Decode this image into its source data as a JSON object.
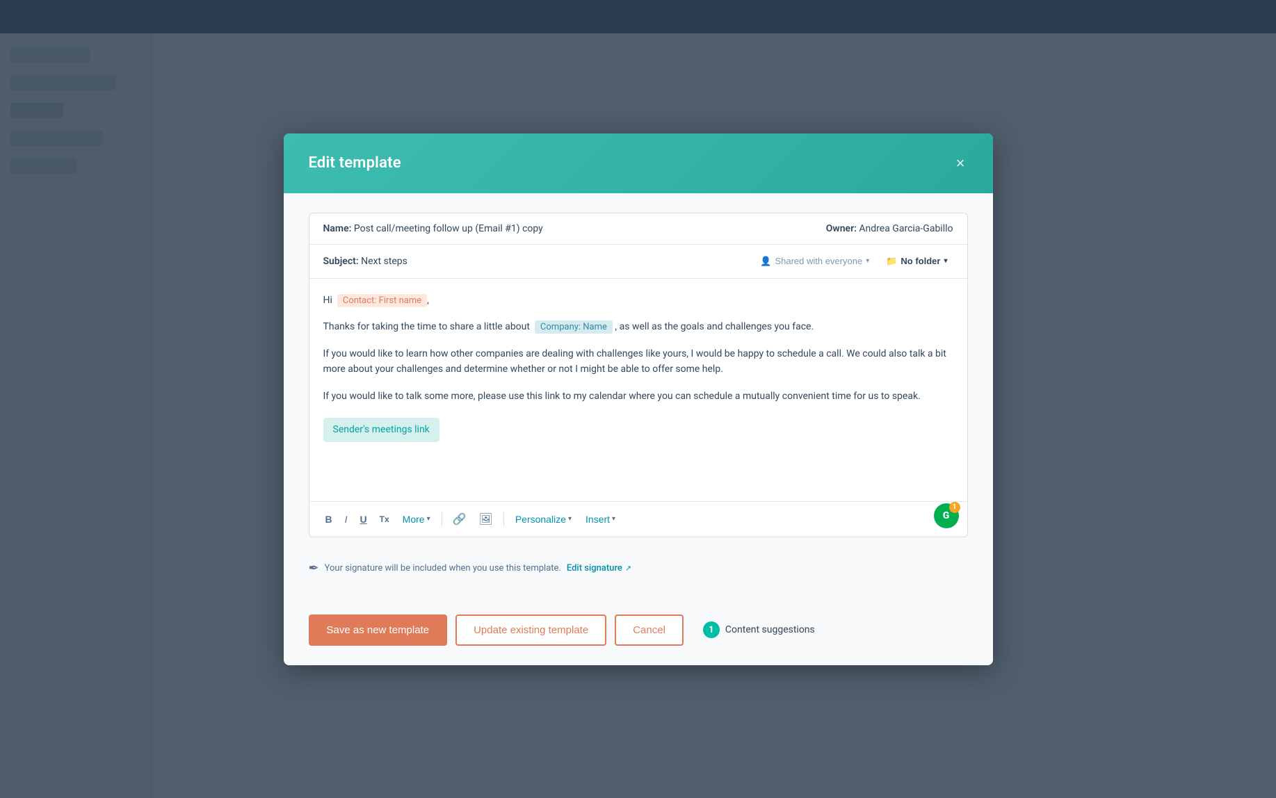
{
  "background": {
    "topbar_color": "#2d3e50",
    "sidebar_color": "#e8edf2",
    "main_color": "#f4f6f8"
  },
  "modal": {
    "title": "Edit template",
    "close_label": "×",
    "header_bg": "#3dbdb1"
  },
  "template": {
    "name_label": "Name:",
    "name_value": "Post call/meeting follow up (Email #1) copy",
    "owner_label": "Owner:",
    "owner_value": "Andrea Garcia-Gabillo",
    "subject_label": "Subject:",
    "subject_value": "Next steps",
    "shared_label": "Shared with everyone",
    "folder_label": "No folder"
  },
  "editor": {
    "line1_before": "Hi",
    "token1": "Contact: First name",
    "line1_after": ",",
    "para2": "Thanks for taking the time to share a little about",
    "token2": "Company: Name",
    "para2_after": ", as well as the goals and challenges you face.",
    "para3": "If you would like to learn how other companies are dealing with challenges like yours, I would be happy to schedule a call. We could also talk a bit more about your challenges and determine whether or not I might be able to offer some help.",
    "para4": "If you would like to talk some more, please use this link to my calendar where you can schedule a mutually convenient time for us to speak.",
    "token3": "Sender's meetings link",
    "grammarly_count": "1"
  },
  "toolbar": {
    "bold_label": "B",
    "italic_label": "I",
    "underline_label": "U",
    "strikethrough_label": "Tx",
    "more_label": "More",
    "personalize_label": "Personalize",
    "insert_label": "Insert"
  },
  "signature_note": {
    "text": "Your signature will be included when you use this template.",
    "link_label": "Edit signature"
  },
  "footer": {
    "save_new_label": "Save as new template",
    "update_label": "Update existing template",
    "cancel_label": "Cancel",
    "content_suggestions_label": "Content suggestions",
    "content_suggestions_count": "1"
  }
}
